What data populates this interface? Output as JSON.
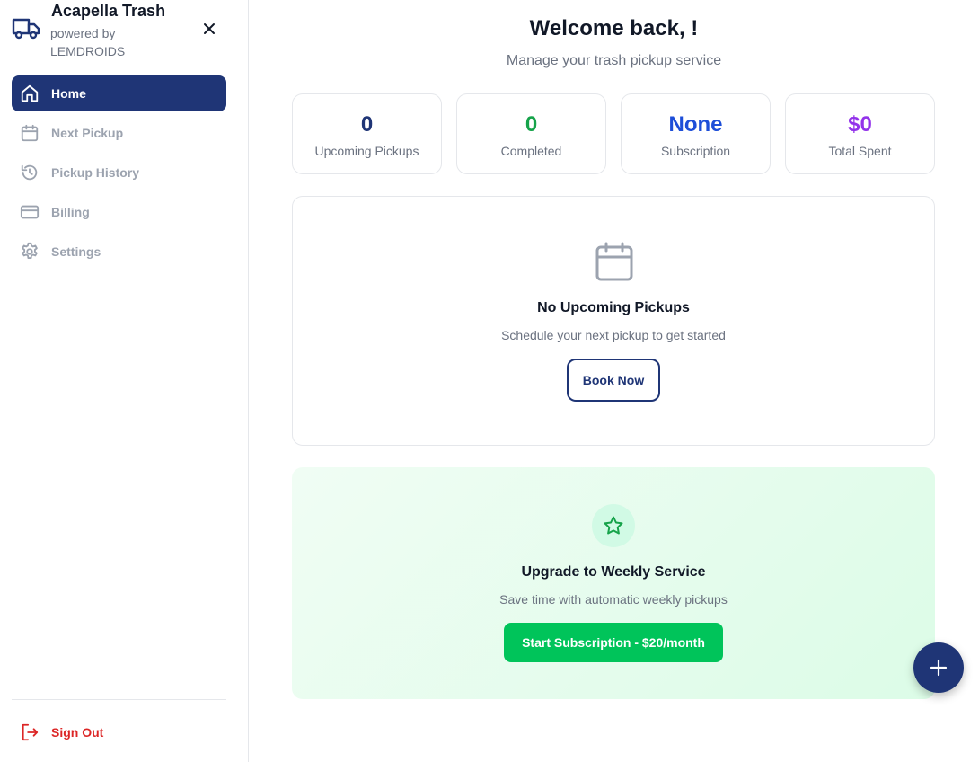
{
  "brand": {
    "title": "Acapella Trash",
    "subtitle": "powered by LEMDROIDS"
  },
  "sidebar": {
    "items": [
      {
        "label": "Home",
        "icon": "home-icon",
        "active": true
      },
      {
        "label": "Next Pickup",
        "icon": "calendar-icon",
        "active": false
      },
      {
        "label": "Pickup History",
        "icon": "history-icon",
        "active": false
      },
      {
        "label": "Billing",
        "icon": "credit-card-icon",
        "active": false
      },
      {
        "label": "Settings",
        "icon": "gear-icon",
        "active": false
      }
    ],
    "signout_label": "Sign Out"
  },
  "header": {
    "welcome": "Welcome back, !",
    "subtitle": "Manage your trash pickup service"
  },
  "stats": [
    {
      "value": "0",
      "label": "Upcoming Pickups",
      "color": "#1f3576"
    },
    {
      "value": "0",
      "label": "Completed",
      "color": "#16a34a"
    },
    {
      "value": "None",
      "label": "Subscription",
      "color": "#1d4ed8"
    },
    {
      "value": "$0",
      "label": "Total Spent",
      "color": "#9333ea"
    }
  ],
  "empty_state": {
    "title": "No Upcoming Pickups",
    "subtitle": "Schedule your next pickup to get started",
    "button_label": "Book Now"
  },
  "upgrade": {
    "title": "Upgrade to Weekly Service",
    "subtitle": "Save time with automatic weekly pickups",
    "button_label": "Start Subscription - $20/month"
  },
  "colors": {
    "primary": "#1f3576",
    "success": "#00c45a",
    "danger": "#dc2626",
    "muted": "#9ca3af"
  }
}
